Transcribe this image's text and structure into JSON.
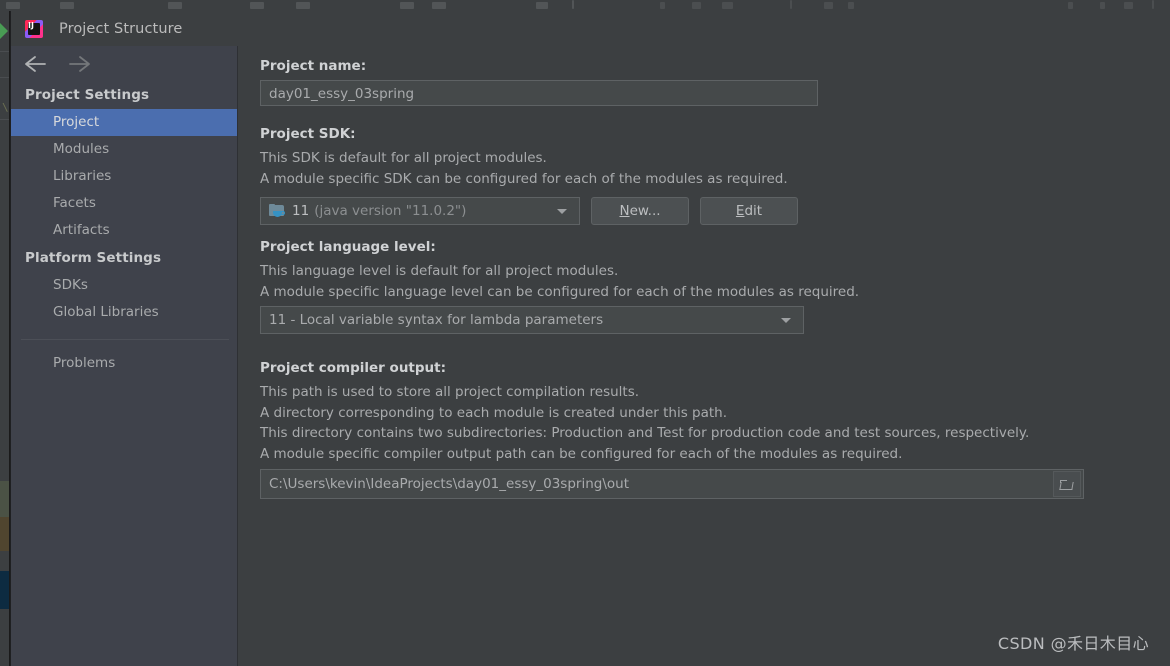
{
  "window": {
    "title": "Project Structure",
    "logo_icon": "intellij-idea-logo",
    "back_icon": "arrow-left-icon",
    "forward_icon": "arrow-right-icon"
  },
  "sidebar": {
    "groups": [
      {
        "header": "Project Settings",
        "items": [
          {
            "label": "Project",
            "selected": true
          },
          {
            "label": "Modules",
            "selected": false
          },
          {
            "label": "Libraries",
            "selected": false
          },
          {
            "label": "Facets",
            "selected": false
          },
          {
            "label": "Artifacts",
            "selected": false
          }
        ]
      },
      {
        "header": "Platform Settings",
        "items": [
          {
            "label": "SDKs",
            "selected": false
          },
          {
            "label": "Global Libraries",
            "selected": false
          }
        ]
      }
    ],
    "problems_label": "Problems"
  },
  "main": {
    "project_name": {
      "label": "Project name:",
      "value": "day01_essy_03spring"
    },
    "project_sdk": {
      "label": "Project SDK:",
      "desc_line1": "This SDK is default for all project modules.",
      "desc_line2": "A module specific SDK can be configured for each of the modules as required.",
      "icon": "java-sdk-folder-icon",
      "version": "11",
      "detail": "(java version \"11.0.2\")",
      "new_button": {
        "mnemonic": "N",
        "rest": "ew..."
      },
      "edit_button": {
        "mnemonic": "E",
        "rest": "dit"
      }
    },
    "language_level": {
      "label": "Project language level:",
      "desc_line1": "This language level is default for all project modules.",
      "desc_line2": "A module specific language level can be configured for each of the modules as required.",
      "value": "11 - Local variable syntax for lambda parameters"
    },
    "compiler_output": {
      "label": "Project compiler output:",
      "desc_line1": "This path is used to store all project compilation results.",
      "desc_line2": "A directory corresponding to each module is created under this path.",
      "desc_line3": "This directory contains two subdirectories: Production and Test for production code and test sources, respectively.",
      "desc_line4": "A module specific compiler output path can be configured for each of the modules as required.",
      "value": "C:\\Users\\kevin\\IdeaProjects\\day01_essy_03spring\\out",
      "browse_icon": "folder-browse-icon"
    }
  },
  "watermark": "CSDN @禾日木目心",
  "colors": {
    "dialog_bg": "#3c3f41",
    "sidebar_bg": "#3f424b",
    "selection": "#4b6eaf",
    "field_bg": "#45494a",
    "border": "#5e6264",
    "text_primary": "#d0d2d4",
    "text_secondary": "#a9abad",
    "accent_green": "#499c54",
    "java_blue": "#3592c4"
  }
}
